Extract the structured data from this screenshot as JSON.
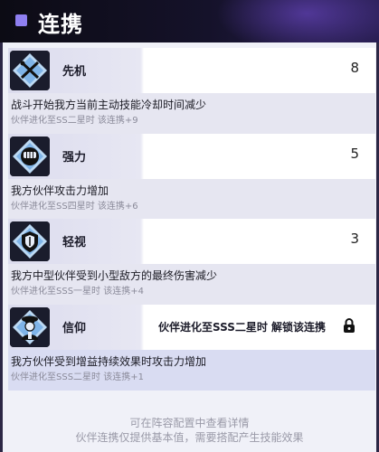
{
  "header": {
    "title": "连携"
  },
  "skills": [
    {
      "name": "先机",
      "value": "8",
      "description": "战斗开始我方当前主动技能冷却时间减少",
      "condition": "伙伴进化至SS二星时 该连携+9",
      "icon": "sword-cross-icon"
    },
    {
      "name": "强力",
      "value": "5",
      "description": "我方伙伴攻击力增加",
      "condition": "伙伴进化至SS四星时 该连携+6",
      "icon": "fist-icon"
    },
    {
      "name": "轻视",
      "value": "3",
      "description": "我方中型伙伴受到小型敌方的最终伤害减少",
      "condition": "伙伴进化至SSS一星时 该连携+4",
      "icon": "shield-icon"
    },
    {
      "name": "信仰",
      "unlock_text": "伙伴进化至SSS二星时 解锁该连携",
      "description": "我方伙伴受到增益持续效果时攻击力增加",
      "condition": "伙伴进化至SSS二星时 该连携+1",
      "icon": "priest-icon",
      "locked": true
    }
  ],
  "footer": {
    "line1": "可在阵容配置中查看详情",
    "line2": "伙伴连携仅提供基本值，需要搭配产生技能效果"
  }
}
